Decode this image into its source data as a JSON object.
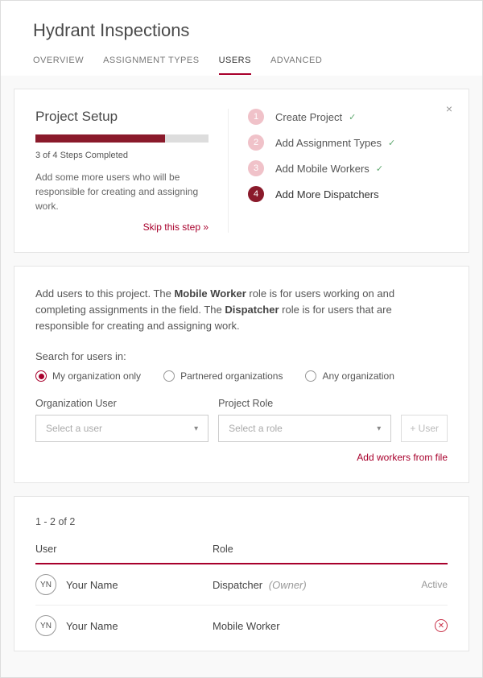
{
  "page_title": "Hydrant Inspections",
  "tabs": [
    {
      "label": "OVERVIEW",
      "active": false
    },
    {
      "label": "ASSIGNMENT TYPES",
      "active": false
    },
    {
      "label": "USERS",
      "active": true
    },
    {
      "label": "ADVANCED",
      "active": false
    }
  ],
  "setup": {
    "title": "Project Setup",
    "progress_label": "3 of 4 Steps Completed",
    "description": "Add some more users who will be responsible for creating and assigning work.",
    "skip_label": "Skip this step »",
    "steps": [
      {
        "num": "1",
        "label": "Create Project",
        "done": true
      },
      {
        "num": "2",
        "label": "Add Assignment Types",
        "done": true
      },
      {
        "num": "3",
        "label": "Add Mobile Workers",
        "done": true
      },
      {
        "num": "4",
        "label": "Add More Dispatchers",
        "done": false
      }
    ]
  },
  "users_intro": {
    "prefix": "Add users to this project. The ",
    "bold1": "Mobile Worker",
    "mid1": " role is for users working on and completing assignments in the field. The ",
    "bold2": "Dispatcher",
    "suffix": " role is for users that are responsible for creating and assigning work."
  },
  "search": {
    "label": "Search for users in:",
    "options": [
      {
        "label": "My organization only",
        "selected": true
      },
      {
        "label": "Partnered organizations",
        "selected": false
      },
      {
        "label": "Any organization",
        "selected": false
      }
    ]
  },
  "selects": {
    "org_user_label": "Organization User",
    "org_user_placeholder": "Select a user",
    "role_label": "Project Role",
    "role_placeholder": "Select a role",
    "add_btn": "+ User",
    "file_link": "Add workers from file"
  },
  "table": {
    "count": "1 - 2 of 2",
    "col_user": "User",
    "col_role": "Role",
    "rows": [
      {
        "initials": "YN",
        "name": "Your Name",
        "role": "Dispatcher",
        "role_suffix": "(Owner)",
        "status": "Active"
      },
      {
        "initials": "YN",
        "name": "Your Name",
        "role": "Mobile Worker",
        "role_suffix": "",
        "status": ""
      }
    ]
  }
}
